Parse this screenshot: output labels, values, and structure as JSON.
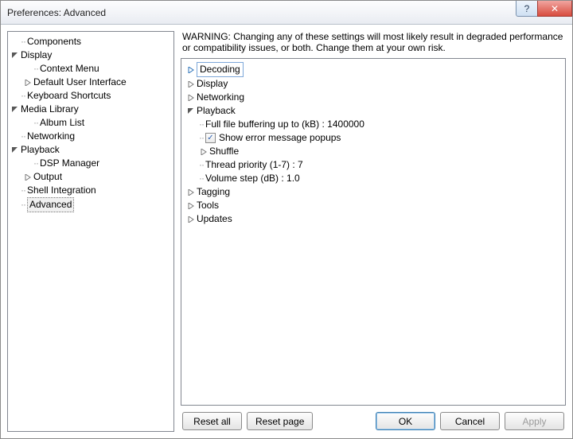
{
  "window": {
    "title": "Preferences: Advanced"
  },
  "sidebar": {
    "items": [
      {
        "label": "Components"
      },
      {
        "label": "Display",
        "expanded": true,
        "children": [
          {
            "label": "Context Menu"
          },
          {
            "label": "Default User Interface",
            "expandable": true
          }
        ]
      },
      {
        "label": "Keyboard Shortcuts"
      },
      {
        "label": "Media Library",
        "expanded": true,
        "children": [
          {
            "label": "Album List"
          }
        ]
      },
      {
        "label": "Networking"
      },
      {
        "label": "Playback",
        "expanded": true,
        "children": [
          {
            "label": "DSP Manager"
          },
          {
            "label": "Output",
            "expandable": true
          }
        ]
      },
      {
        "label": "Shell Integration"
      },
      {
        "label": "Advanced",
        "selected": true
      }
    ]
  },
  "main": {
    "warning": "WARNING: Changing any of these settings will most likely result in degraded performance or compatibility issues, or both. Change them at your own risk.",
    "options": [
      {
        "label": "Decoding",
        "expandable": true,
        "selected": true
      },
      {
        "label": "Display",
        "expandable": true
      },
      {
        "label": "Networking",
        "expandable": true
      },
      {
        "label": "Playback",
        "expanded": true,
        "children": [
          {
            "label": "Full file buffering up to (kB) : 1400000"
          },
          {
            "label": "Show error message popups",
            "checked": true
          },
          {
            "label": "Shuffle",
            "expandable": true
          },
          {
            "label": "Thread priority (1-7) : 7"
          },
          {
            "label": "Volume step (dB) : 1.0"
          }
        ]
      },
      {
        "label": "Tagging",
        "expandable": true
      },
      {
        "label": "Tools",
        "expandable": true
      },
      {
        "label": "Updates",
        "expandable": true
      }
    ]
  },
  "buttons": {
    "reset_all": "Reset all",
    "reset_page": "Reset page",
    "ok": "OK",
    "cancel": "Cancel",
    "apply": "Apply"
  }
}
